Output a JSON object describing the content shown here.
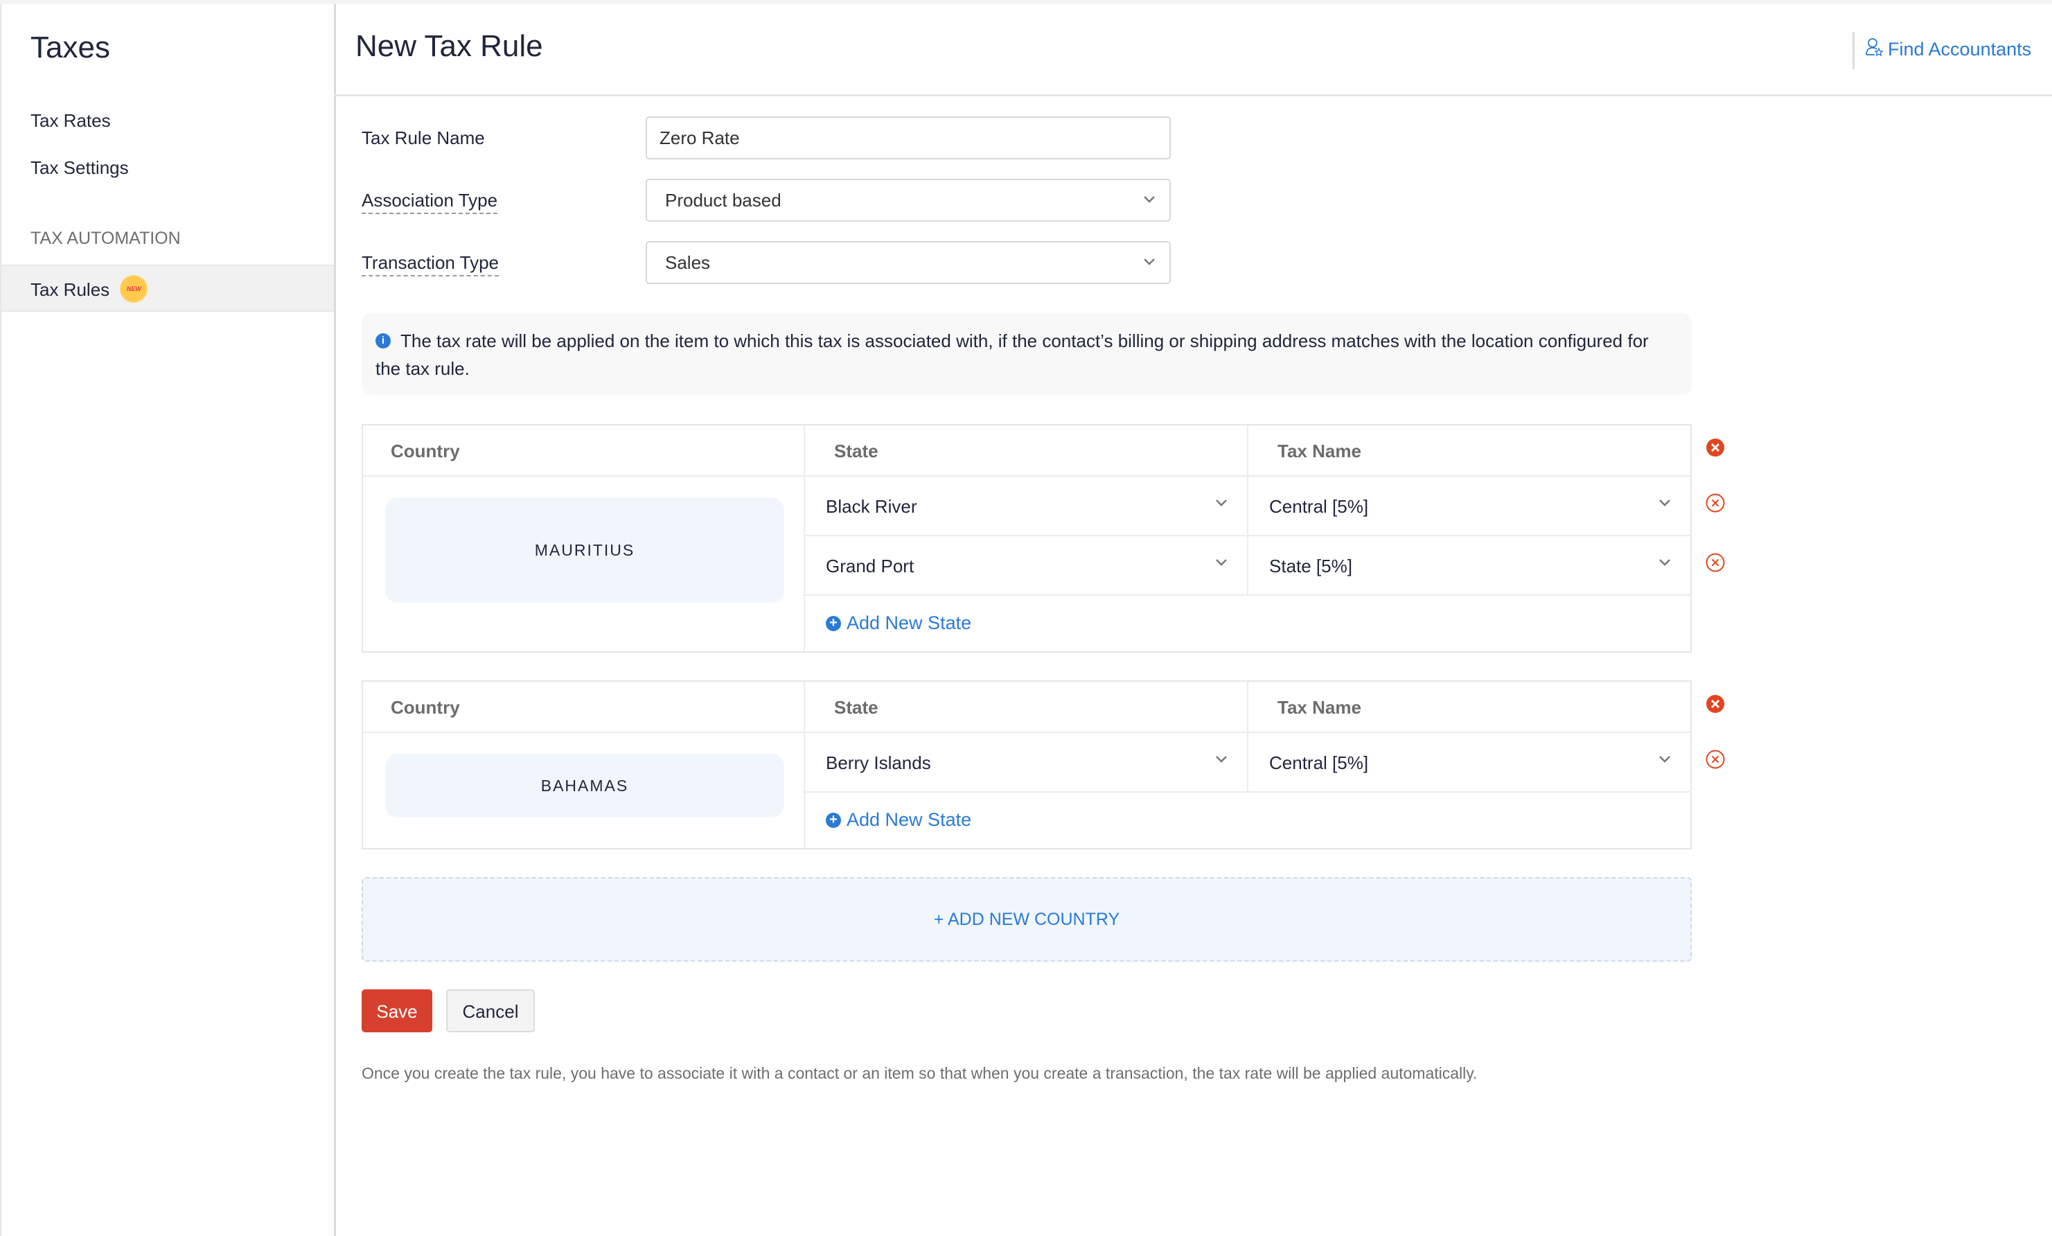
{
  "sidebar": {
    "title": "Taxes",
    "items": [
      {
        "label": "Tax Rates"
      },
      {
        "label": "Tax Settings"
      }
    ],
    "section_label": "TAX AUTOMATION",
    "automation_items": [
      {
        "label": "Tax Rules",
        "badge": "NEW",
        "active": true
      }
    ]
  },
  "header": {
    "title": "New Tax Rule",
    "find_accountants_label": "Find Accountants"
  },
  "form": {
    "rule_name_label": "Tax Rule Name",
    "rule_name_value": "Zero Rate",
    "association_type_label": "Association Type",
    "association_type_value": "Product based",
    "transaction_type_label": "Transaction Type",
    "transaction_type_value": "Sales"
  },
  "info_text": "The tax rate will be applied on the item to which this tax is associated with, if the contact’s billing or shipping address matches with the location configured for the tax rule.",
  "table_headers": {
    "country": "Country",
    "state": "State",
    "tax_name": "Tax Name"
  },
  "countries": [
    {
      "name": "MAURITIUS",
      "rows": [
        {
          "state": "Black River",
          "tax": "Central [5%]"
        },
        {
          "state": "Grand Port",
          "tax": "State [5%]"
        }
      ],
      "add_state_label": "Add New State"
    },
    {
      "name": "BAHAMAS",
      "rows": [
        {
          "state": "Berry Islands",
          "tax": "Central [5%]"
        }
      ],
      "add_state_label": "Add New State"
    }
  ],
  "add_country_label": "+ ADD NEW COUNTRY",
  "buttons": {
    "save": "Save",
    "cancel": "Cancel"
  },
  "footnote": "Once you create the tax rule, you have to associate it with a contact or an item so that when you create a transaction, the tax rate will be applied automatically.",
  "colors": {
    "accent": "#2a7ad6",
    "danger": "#d6412f",
    "country_bg": "#f1f6fd"
  }
}
